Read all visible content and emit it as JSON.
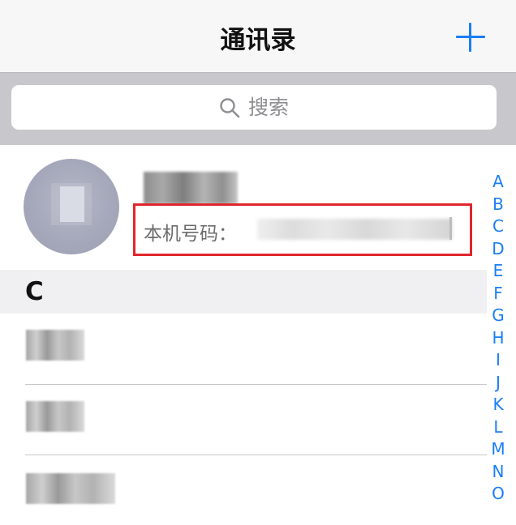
{
  "navbar": {
    "title": "通讯录",
    "add_icon": "plus-icon"
  },
  "search": {
    "icon": "search-icon",
    "placeholder": "搜索"
  },
  "my_card": {
    "phone_label": "本机号码："
  },
  "section": {
    "letter": "C"
  },
  "index": [
    "A",
    "B",
    "C",
    "D",
    "E",
    "F",
    "G",
    "H",
    "I",
    "J",
    "K",
    "L",
    "M",
    "N",
    "O"
  ],
  "colors": {
    "accent": "#1a7ef5",
    "highlight_box": "#e0262c",
    "search_bg": "#c8c7cc"
  }
}
